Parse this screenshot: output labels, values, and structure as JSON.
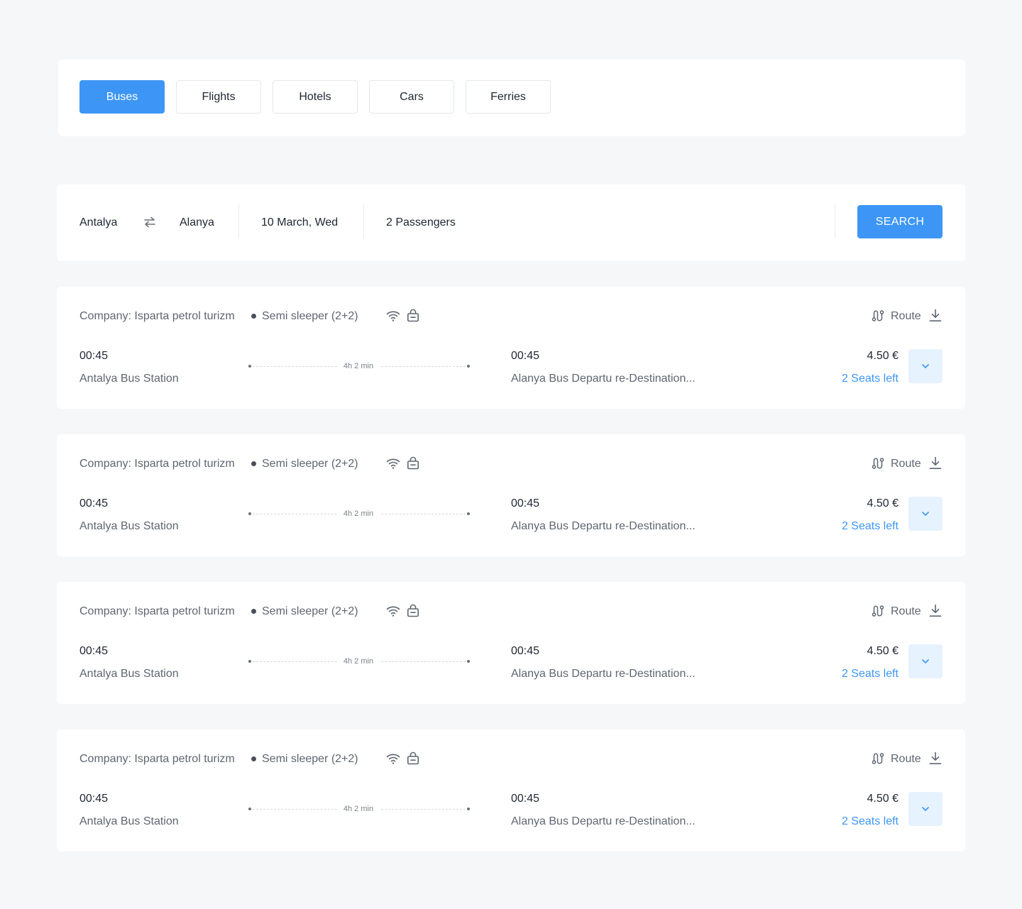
{
  "tabs": [
    {
      "label": "Buses",
      "active": true
    },
    {
      "label": "Flights",
      "active": false
    },
    {
      "label": "Hotels",
      "active": false
    },
    {
      "label": "Cars",
      "active": false
    },
    {
      "label": "Ferries",
      "active": false
    }
  ],
  "search": {
    "from": "Antalya",
    "to": "Alanya",
    "date": "10 March, Wed",
    "passengers": "2 Passengers",
    "button_label": "SEARCH",
    "swap_icon": "swap-arrows-icon"
  },
  "results": [
    {
      "company": "Company: Isparta petrol turizm",
      "seat_class": "Semi sleeper (2+2)",
      "amenities": [
        "wifi-icon",
        "luggage-icon"
      ],
      "route_label": "Route",
      "departure_time": "00:45",
      "departure_station": "Antalya Bus Station",
      "duration": "4h 2 min",
      "arrival_time": "00:45",
      "arrival_station": "Alanya Bus Departu re-Destination...",
      "price": "4.50 €",
      "seats_left": "2 Seats left"
    },
    {
      "company": "Company: Isparta petrol turizm",
      "seat_class": "Semi sleeper (2+2)",
      "amenities": [
        "wifi-icon",
        "luggage-icon"
      ],
      "route_label": "Route",
      "departure_time": "00:45",
      "departure_station": "Antalya Bus Station",
      "duration": "4h 2 min",
      "arrival_time": "00:45",
      "arrival_station": "Alanya Bus Departu re-Destination...",
      "price": "4.50 €",
      "seats_left": "2 Seats left"
    },
    {
      "company": "Company: Isparta petrol turizm",
      "seat_class": "Semi sleeper (2+2)",
      "amenities": [
        "wifi-icon",
        "luggage-icon"
      ],
      "route_label": "Route",
      "departure_time": "00:45",
      "departure_station": "Antalya Bus Station",
      "duration": "4h 2 min",
      "arrival_time": "00:45",
      "arrival_station": "Alanya Bus Departu re-Destination...",
      "price": "4.50 €",
      "seats_left": "2 Seats left"
    },
    {
      "company": "Company: Isparta petrol turizm",
      "seat_class": "Semi sleeper (2+2)",
      "amenities": [
        "wifi-icon",
        "luggage-icon"
      ],
      "route_label": "Route",
      "departure_time": "00:45",
      "departure_station": "Antalya Bus Station",
      "duration": "4h 2 min",
      "arrival_time": "00:45",
      "arrival_station": "Alanya Bus Departu re-Destination...",
      "price": "4.50 €",
      "seats_left": "2 Seats left"
    }
  ],
  "colors": {
    "accent": "#3d96f5",
    "accent_light": "#e6f2fe",
    "background": "#f6f7f9",
    "text_primary": "#1f2733",
    "text_secondary": "#5f6670"
  }
}
